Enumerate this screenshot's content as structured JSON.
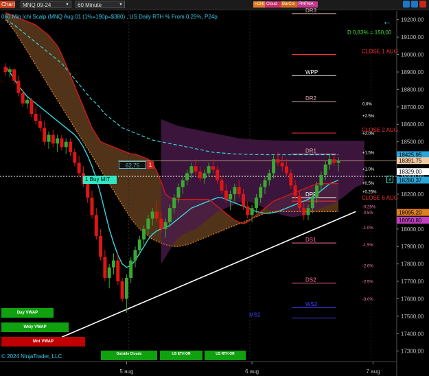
{
  "toolbar": {
    "chart_tab": "Chart",
    "instrument": "MNQ 09-24",
    "interval": "60 Minute",
    "indicators": [
      "I-CHI",
      "Cloud",
      "BarCol",
      "PMFMA"
    ]
  },
  "chart_title": "060 Min Ichi Scalp (MNQ Aug 01  (1%=190p=$380) , US Daily RTH % From 0.25%, P24p",
  "distance_label": "D 0,83% = 150,00",
  "copyright": "© 2024 NinjaTrader, LLC",
  "order": {
    "label": "1  Buy MIT",
    "pl_value": "62,75",
    "quantity": "1",
    "cancel": "x"
  },
  "buttons": {
    "day_vwap": "Day VWAP",
    "wkly_vwap": "Wkly VWAP",
    "mnt_vwap": "Mnt VWAP",
    "outside_clouds": "Outside Clouds",
    "us_eth_or": "US ETH OR",
    "us_rth_or": "US RTH OR"
  },
  "colors": {
    "background": "#000000",
    "bull_candle": "#3aa832",
    "bear_candle": "#e01515",
    "kijun_cyan": "#36d6e0",
    "cloud_brown": "#6b4422",
    "cloud_purple": "#4a1a4a",
    "orange_dotted": "#f08a1a",
    "red_line": "#d01a1a"
  },
  "chart_data": {
    "type": "candlestick",
    "title": "060 Min Ichi Scalp (MNQ Aug 01  (1%=190p=$380) , US Daily RTH % From 0.25%, P24p",
    "y_ticks": [
      19200,
      19100,
      19000,
      18900,
      18800,
      18700,
      18600,
      18500,
      18400,
      18300,
      18200,
      18100,
      18000,
      17900,
      17800,
      17700,
      17600,
      17500,
      17400,
      17300
    ],
    "y_tick_labels": [
      "19200,00",
      "19100,00",
      "19000,00",
      "18900,00",
      "18800,00",
      "18700,00",
      "18600,00",
      "18500,00",
      "18400,00",
      "18300,00",
      "18200,00",
      "18100,00",
      "18000,00",
      "17900,00",
      "17800,00",
      "17700,00",
      "17600,00",
      "17500,00",
      "17400,00",
      "17300,00"
    ],
    "ylim": [
      17240,
      19250
    ],
    "x_labels": [
      {
        "label": "5 aug",
        "bar": 28
      },
      {
        "label": "6 aug",
        "bar": 57
      },
      {
        "label": "7 aug",
        "bar": 85
      }
    ],
    "price_tags": [
      {
        "label": "18425,95",
        "price": 18425.95,
        "color": "#2aa6d8"
      },
      {
        "label": "18391,75",
        "price": 18391.75,
        "color": "#f0c8a0"
      },
      {
        "label": "18329,00",
        "price": 18329.0,
        "color": "#ffffff"
      },
      {
        "label": "18280,37",
        "price": 18280.37,
        "color": "#2aa6d8"
      },
      {
        "label": "18095,20",
        "price": 18095.2,
        "color": "#e08020"
      },
      {
        "label": "18050,80",
        "price": 18050.8,
        "color": "#c040c0"
      }
    ],
    "levels": [
      {
        "label": "DR3",
        "price": 19235,
        "color": "#e0b0b0"
      },
      {
        "label": "CLOSE 1 AUG",
        "price": 19000,
        "color": "#ff3030"
      },
      {
        "label": "WPP",
        "price": 18880,
        "color": "#ffffff"
      },
      {
        "label": "DR2",
        "price": 18730,
        "color": "#e0b0b0"
      },
      {
        "label": "CLOSE 2 AUG",
        "price": 18550,
        "color": "#ff3030"
      },
      {
        "label": "DR1",
        "price": 18430,
        "color": "#e0b0b0"
      },
      {
        "label": "DPP",
        "price": 18180,
        "color": "#ffffff"
      },
      {
        "label": "CLOSE 6 AUG",
        "price": 18160,
        "color": "#ff3030"
      },
      {
        "label": "DS1",
        "price": 17920,
        "color": "#ff70a0"
      },
      {
        "label": "DS2",
        "price": 17690,
        "color": "#ff70a0"
      },
      {
        "label": "WS2",
        "price": 17550,
        "color": "#4040ff"
      },
      {
        "label": "MS2",
        "price": 17490,
        "color": "#4040ff"
      }
    ],
    "pct_levels": [
      {
        "label": "0.0%",
        "price": 18710
      },
      {
        "label": "+2.5%",
        "price": 18640
      },
      {
        "label": "+2.0%",
        "price": 18540
      },
      {
        "label": "+1.5%",
        "price": 18430
      },
      {
        "label": "+1.0%",
        "price": 18335
      },
      {
        "label": "+0.5%",
        "price": 18255
      },
      {
        "label": "+0.25%",
        "price": 18205
      },
      {
        "label": "-0.25%",
        "price": 18120
      },
      {
        "label": "-0.5%",
        "price": 18085
      },
      {
        "label": "-1.0%",
        "price": 18000
      },
      {
        "label": "-1.5%",
        "price": 17900
      },
      {
        "label": "-2.0%",
        "price": 17780
      },
      {
        "label": "-2.5%",
        "price": 17690
      },
      {
        "label": "-3.0%",
        "price": 17590
      }
    ],
    "candles": [
      [
        18930,
        18950,
        18880,
        18900
      ],
      [
        18900,
        18930,
        18870,
        18915
      ],
      [
        18915,
        18920,
        18830,
        18850
      ],
      [
        18850,
        18880,
        18760,
        18780
      ],
      [
        18780,
        18800,
        18700,
        18720
      ],
      [
        18720,
        18760,
        18690,
        18740
      ],
      [
        18740,
        18750,
        18640,
        18660
      ],
      [
        18660,
        18700,
        18600,
        18620
      ],
      [
        18620,
        18660,
        18560,
        18580
      ],
      [
        18580,
        18620,
        18480,
        18500
      ],
      [
        18500,
        18560,
        18460,
        18540
      ],
      [
        18540,
        18570,
        18470,
        18490
      ],
      [
        18490,
        18540,
        18440,
        18520
      ],
      [
        18520,
        18540,
        18450,
        18470
      ],
      [
        18470,
        18520,
        18430,
        18500
      ],
      [
        18500,
        18520,
        18420,
        18440
      ],
      [
        18440,
        18460,
        18360,
        18380
      ],
      [
        18380,
        18420,
        18300,
        18320
      ],
      [
        18320,
        18360,
        18240,
        18260
      ],
      [
        18260,
        18300,
        18150,
        18180
      ],
      [
        18180,
        18220,
        18060,
        18080
      ],
      [
        18080,
        18120,
        17940,
        17960
      ],
      [
        17960,
        18000,
        17820,
        17840
      ],
      [
        17840,
        17880,
        17700,
        17720
      ],
      [
        17720,
        17800,
        17660,
        17780
      ],
      [
        17780,
        17860,
        17740,
        17820
      ],
      [
        17820,
        17860,
        17680,
        17700
      ],
      [
        17700,
        17720,
        17580,
        17600
      ],
      [
        17600,
        17740,
        17520,
        17720
      ],
      [
        17720,
        17840,
        17690,
        17820
      ],
      [
        17820,
        17900,
        17780,
        17880
      ],
      [
        17880,
        17960,
        17850,
        17940
      ],
      [
        17940,
        18020,
        17910,
        18000
      ],
      [
        18000,
        18080,
        17970,
        18060
      ],
      [
        18060,
        18120,
        18020,
        18100
      ],
      [
        18100,
        18160,
        18040,
        18060
      ],
      [
        18060,
        18100,
        17980,
        18000
      ],
      [
        18000,
        18060,
        17950,
        18040
      ],
      [
        18040,
        18140,
        18010,
        18120
      ],
      [
        18120,
        18200,
        18090,
        18180
      ],
      [
        18180,
        18260,
        18150,
        18240
      ],
      [
        18240,
        18300,
        18200,
        18280
      ],
      [
        18280,
        18340,
        18250,
        18320
      ],
      [
        18320,
        18380,
        18290,
        18360
      ],
      [
        18360,
        18400,
        18310,
        18330
      ],
      [
        18330,
        18360,
        18270,
        18290
      ],
      [
        18290,
        18340,
        18260,
        18320
      ],
      [
        18320,
        18380,
        18300,
        18360
      ],
      [
        18360,
        18400,
        18320,
        18340
      ],
      [
        18340,
        18360,
        18260,
        18280
      ],
      [
        18280,
        18300,
        18200,
        18220
      ],
      [
        18220,
        18260,
        18150,
        18170
      ],
      [
        18170,
        18220,
        18110,
        18200
      ],
      [
        18200,
        18260,
        18160,
        18240
      ],
      [
        18240,
        18280,
        18180,
        18200
      ],
      [
        18200,
        18230,
        18110,
        18130
      ],
      [
        18130,
        18160,
        18060,
        18080
      ],
      [
        18080,
        18140,
        18040,
        18120
      ],
      [
        18120,
        18200,
        18090,
        18180
      ],
      [
        18180,
        18260,
        18150,
        18240
      ],
      [
        18240,
        18300,
        18200,
        18280
      ],
      [
        18280,
        18340,
        18250,
        18320
      ],
      [
        18320,
        18420,
        18290,
        18400
      ],
      [
        18400,
        18440,
        18360,
        18380
      ],
      [
        18380,
        18420,
        18330,
        18360
      ],
      [
        18360,
        18400,
        18300,
        18320
      ],
      [
        18320,
        18340,
        18230,
        18250
      ],
      [
        18250,
        18280,
        18170,
        18190
      ],
      [
        18190,
        18220,
        18100,
        18120
      ],
      [
        18120,
        18150,
        18050,
        18080
      ],
      [
        18080,
        18140,
        18050,
        18120
      ],
      [
        18120,
        18200,
        18090,
        18180
      ],
      [
        18180,
        18270,
        18150,
        18250
      ],
      [
        18250,
        18330,
        18220,
        18310
      ],
      [
        18310,
        18390,
        18280,
        18370
      ],
      [
        18370,
        18430,
        18340,
        18400
      ],
      [
        18400,
        18430,
        18360,
        18380
      ],
      [
        18380,
        18410,
        18330,
        18392
      ]
    ],
    "series_lines": [
      {
        "name": "kijun",
        "color": "#36d6e0",
        "style": "solid",
        "values": [
          18930,
          18900,
          18860,
          18820,
          18790,
          18760,
          18740,
          18720,
          18700,
          18680,
          18660,
          18640,
          18620,
          18600,
          18580,
          18560,
          18540,
          18510,
          18470,
          18420,
          18360,
          18290,
          18200,
          18100,
          18000,
          17920,
          17850,
          17800,
          17780,
          17790,
          17820,
          17860,
          17900,
          17940,
          17970,
          17990,
          18000,
          18010,
          18020,
          18040,
          18060,
          18080,
          18100,
          18120,
          18130,
          18140,
          18150,
          18160,
          18170,
          18180,
          18180,
          18170,
          18160,
          18150,
          18140,
          18130,
          18120,
          18110,
          18100,
          18095,
          18090,
          18090,
          18095,
          18100,
          18110,
          18120,
          18130,
          18140,
          18150,
          18160,
          18170,
          18185,
          18200,
          18220,
          18240,
          18260,
          18270,
          18280
        ]
      },
      {
        "name": "ma-dashed",
        "color": "#36d6e0",
        "style": "dashed",
        "values": [
          19200,
          19185,
          19170,
          19150,
          19130,
          19110,
          19090,
          19070,
          19050,
          19030,
          19010,
          18990,
          18970,
          18950,
          18920,
          18890,
          18860,
          18830,
          18800,
          18770,
          18740,
          18720,
          18690,
          18660,
          18640,
          18620,
          18600,
          18580,
          18570,
          18560,
          18550,
          18540,
          18530,
          18520,
          18510,
          18505,
          18500,
          18495,
          18490,
          18485,
          18480,
          18475,
          18470,
          18465,
          18460,
          18455,
          18450,
          18445,
          18440,
          18438,
          18436,
          18434,
          18432,
          18430,
          18430,
          18429,
          18428,
          18428,
          18427,
          18427,
          18426,
          18426,
          18426,
          18426,
          18426,
          18426,
          18426,
          18426,
          18426,
          18426,
          18426,
          18426,
          18426,
          18426,
          18426,
          18426,
          18426,
          18426
        ]
      },
      {
        "name": "orange-dotted",
        "color": "#f08a1a",
        "style": "dotted",
        "values": [
          19200,
          19170,
          19140,
          19100,
          19060,
          19020,
          18980,
          18940,
          18900,
          18860,
          18820,
          18780,
          18740,
          18700,
          18660,
          18620,
          18580,
          18540,
          18500,
          18460,
          18420,
          18380,
          18340,
          18300,
          18260,
          18220,
          18180,
          18140,
          18100,
          18060,
          18030,
          18000,
          17980,
          17960,
          17940,
          17930,
          17920,
          17910,
          17905,
          17900,
          17900,
          17905,
          17910,
          17920,
          17930,
          17940,
          17950,
          17960,
          17970,
          17980,
          17990,
          18000,
          18010,
          18020,
          18030,
          18040,
          18050,
          18060,
          18070,
          18080,
          18090,
          18095,
          18100,
          18100,
          18100,
          18100,
          18100,
          18100,
          18100,
          18100,
          18100,
          18100,
          18100,
          18100,
          18100,
          18100,
          18100,
          18100
        ]
      },
      {
        "name": "red-line",
        "color": "#d01a1a",
        "style": "solid",
        "values": [
          19240,
          19230,
          19220,
          19210,
          19200,
          19190,
          19180,
          19170,
          19150,
          19130,
          19110,
          19080,
          19050,
          19000,
          18940,
          18880,
          18820,
          18760,
          18700,
          18640,
          18580,
          18540,
          18500,
          18490,
          18480,
          18470,
          18460,
          18450,
          18440,
          18430,
          18430,
          18420,
          18410,
          18400,
          18380,
          18330,
          18270,
          18200,
          18180,
          18170,
          18170,
          18170,
          18170,
          18170,
          18170,
          18170,
          18170,
          18170,
          18150,
          18130,
          18110,
          18090,
          18070,
          18050,
          18040,
          18030,
          18040,
          18060,
          18080,
          18100,
          18120,
          18140,
          18160,
          18170,
          18180,
          18190,
          18200,
          18210,
          18220,
          18230,
          18240,
          18250,
          18260,
          18260,
          18260,
          18260,
          18260,
          18260
        ]
      }
    ],
    "trendline": {
      "from": {
        "bar": 13,
        "price": 17380
      },
      "to": {
        "bar": 81,
        "price": 18100
      }
    }
  }
}
